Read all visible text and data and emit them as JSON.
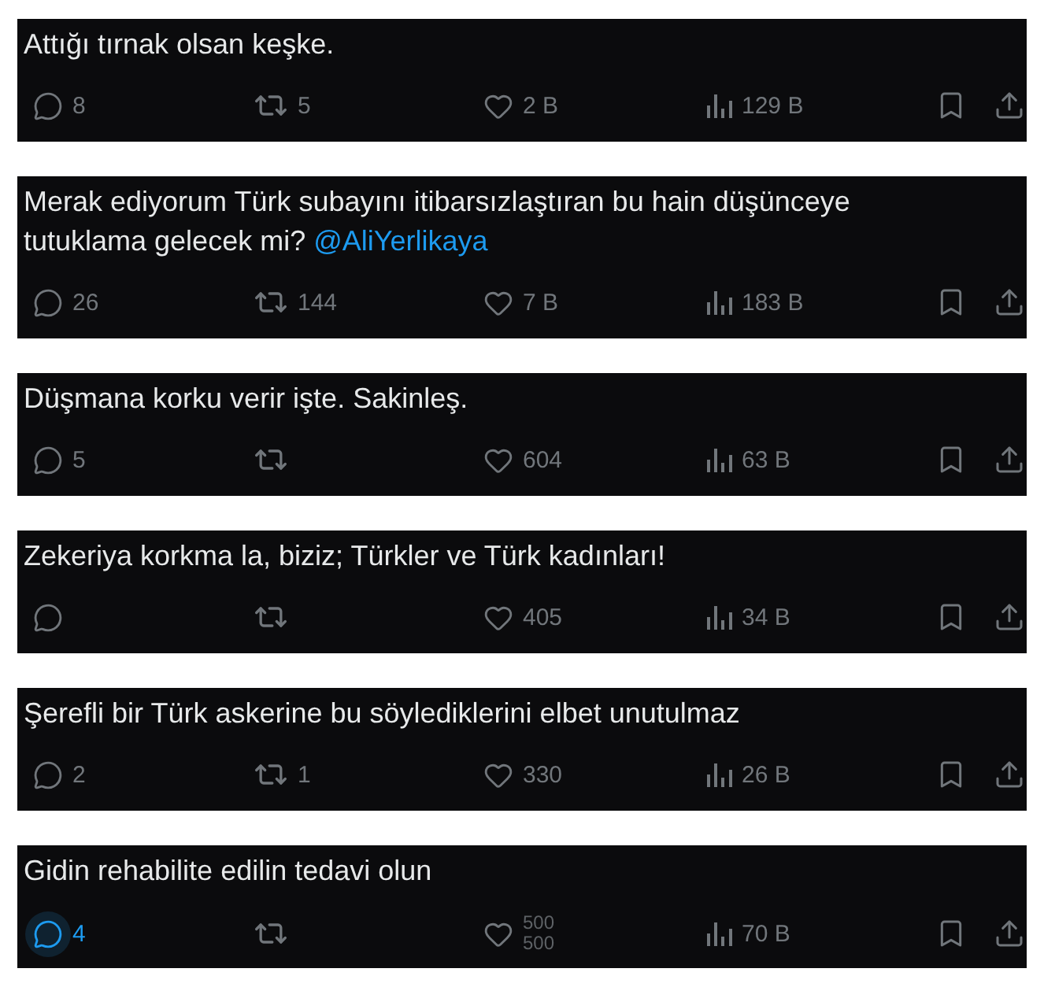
{
  "tweets": [
    {
      "text": "Attığı tırnak olsan keşke.",
      "reply_count": "8",
      "reply_highlighted": false,
      "repost_count": "5",
      "like_count": "2 B",
      "view_count": "129 B"
    },
    {
      "text": "Merak ediyorum Türk subayını itibarsızlaştıran bu hain düşünceye tutuklama gelecek mi?",
      "mention": "@AliYerlikaya",
      "reply_count": "26",
      "reply_highlighted": false,
      "repost_count": "144",
      "like_count": "7 B",
      "view_count": "183 B"
    },
    {
      "text": "Düşmana korku verir işte. Sakinleş.",
      "reply_count": "5",
      "reply_highlighted": false,
      "like_count": "604",
      "view_count": "63 B"
    },
    {
      "text": "Zekeriya korkma la, biziz; Türkler ve Türk kadınları!",
      "reply_highlighted": false,
      "like_count": "405",
      "view_count": "34 B"
    },
    {
      "text": "Şerefli bir Türk askerine bu söylediklerini elbet unutulmaz",
      "reply_count": "2",
      "reply_highlighted": false,
      "repost_count": "1",
      "like_count": "330",
      "view_count": "26 B"
    },
    {
      "text": "Gidin rehabilite edilin tedavi olun",
      "reply_count": "4",
      "reply_highlighted": true,
      "like_count_rolling": [
        "500",
        "500"
      ],
      "view_count": "70 B"
    }
  ]
}
